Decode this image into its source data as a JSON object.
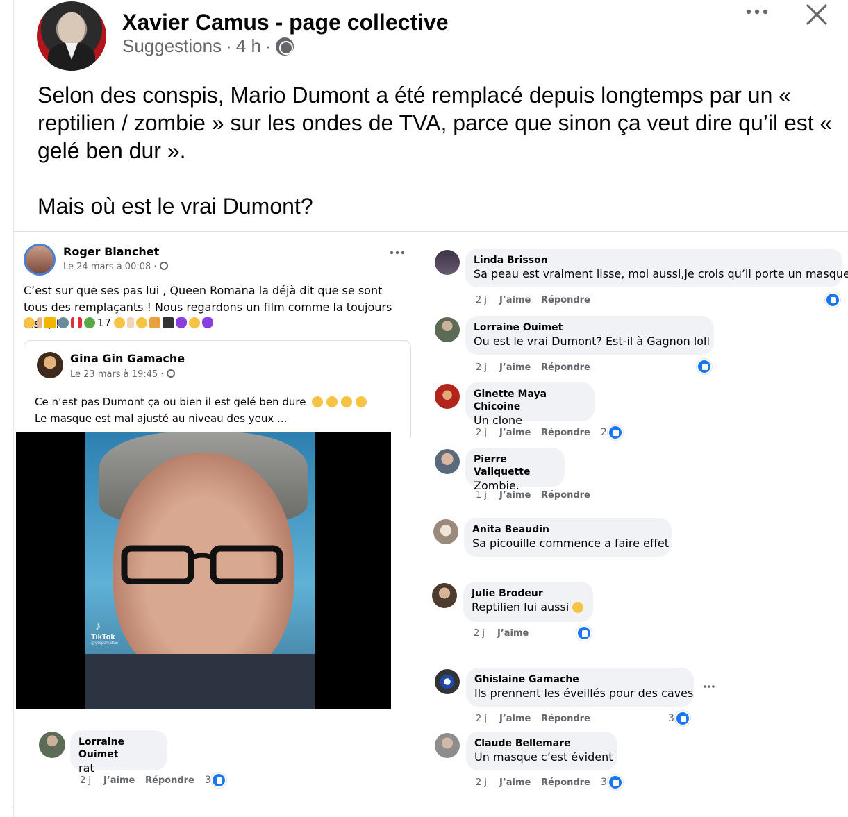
{
  "post": {
    "page_name": "Xavier Camus - page collective",
    "meta_label": "Suggestions",
    "meta_sep1": "·",
    "meta_time": "4 h",
    "meta_sep2": "·",
    "text_line1": "Selon des conspis, Mario Dumont a été remplacé depuis longtemps par un « reptilien / zombie » sur les ondes de TVA, parce que sinon ça veut dire qu’il est « gelé ben dur ».",
    "text_line2": "Mais où est le vrai Dumont?"
  },
  "icons": {
    "more": "more-horizontal-icon",
    "close": "close-icon",
    "audience": "globe-icon",
    "like": "like-icon"
  },
  "embedded": {
    "author": "Roger Blanchet",
    "date": "Le 24 mars à 00:08 ·",
    "text": "C’est sur que ses pas lui , Queen Romana la déjà dit que se sont tous des remplaçants ! Nous regardons un film comme la toujours dis Q !",
    "emoji_count": "17",
    "shared": {
      "author": "Gina Gin Gamache",
      "date": "Le 23 mars à 19:45 ·",
      "text_line1": "Ce n’est pas Dumont ça ou bien il est gelé ben dure",
      "text_line2": "Le masque est mal ajusté au niveau des yeux ..."
    },
    "video_watermark": "TikTok",
    "video_handle": "@gregoryatlas"
  },
  "comments_left": [
    {
      "name": "Lorraine Ouimet",
      "text": "rat",
      "time": "2 j",
      "like": "J’aime",
      "reply": "Répondre",
      "reactions": "3"
    }
  ],
  "comments_right": [
    {
      "name": "Linda Brisson",
      "text": "Sa peau est vraiment lisse, moi aussi,je crois qu’il porte un masque",
      "time": "2 j",
      "like": "J’aime",
      "reply": "Répondre",
      "reactions": ""
    },
    {
      "name": "Lorraine Ouimet",
      "text": "Ou est le vrai Dumont? Est-il à Gagnon loll",
      "time": "2 j",
      "like": "J’aime",
      "reply": "Répondre",
      "reactions": ""
    },
    {
      "name": "Ginette Maya Chicoine",
      "text": "Un clone",
      "time": "2 j",
      "like": "J’aime",
      "reply": "Répondre",
      "reactions": "2"
    },
    {
      "name": "Pierre Valiquette",
      "text": "Zombie.",
      "time": "1 j",
      "like": "J’aime",
      "reply": "Répondre",
      "reactions": ""
    },
    {
      "name": "Anita Beaudin",
      "text": "Sa picouille commence a faire effet",
      "time": "",
      "like": "",
      "reply": "",
      "reactions": ""
    },
    {
      "name": "Julie Brodeur",
      "text": "Reptilien lui aussi",
      "time": "2 j",
      "like": "J’aime",
      "reply": "",
      "reactions": ""
    },
    {
      "name": "Ghislaine Gamache",
      "text": "Ils prennent les éveillés pour des caves",
      "time": "2 j",
      "like": "J’aime",
      "reply": "Répondre",
      "reactions": "3"
    },
    {
      "name": "Claude Bellemare",
      "text": "Un masque c’est évident",
      "time": "2 j",
      "like": "J’aime",
      "reply": "Répondre",
      "reactions": "3"
    }
  ],
  "colors": {
    "text": "#050505",
    "secondary": "#65676b",
    "bubble": "#f0f2f5",
    "like_blue": "#1877f2",
    "avatar_ring": "#4a7fd4"
  }
}
